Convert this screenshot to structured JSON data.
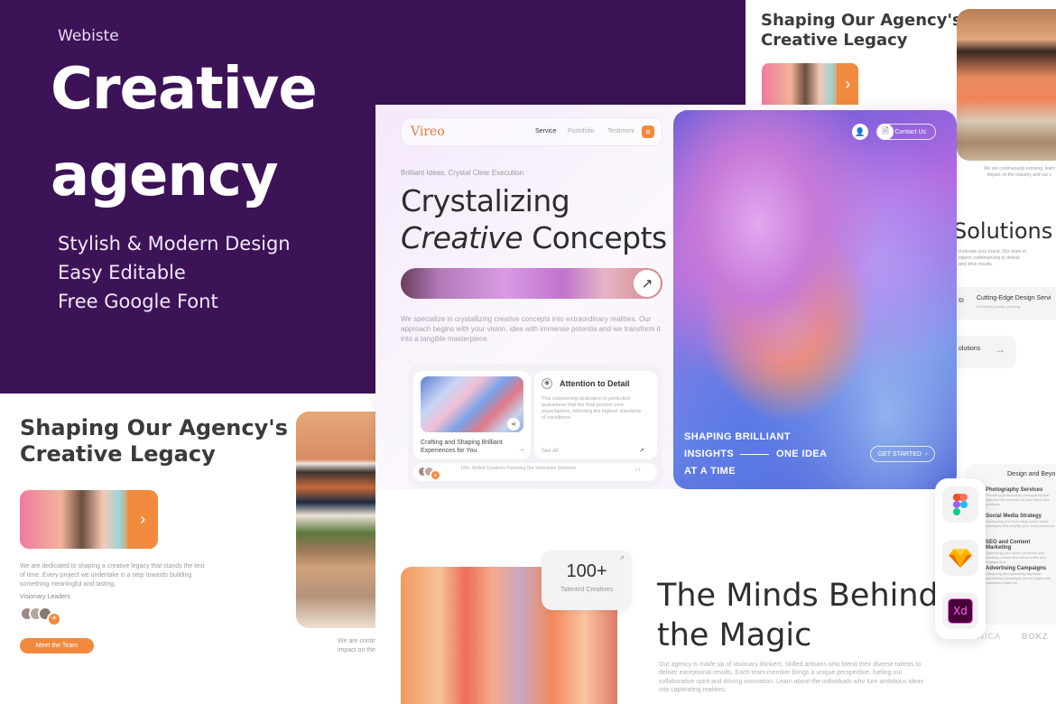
{
  "hero": {
    "tag": "Webiste",
    "title_line1": "Creative",
    "title_line2": "agency",
    "features": [
      "Stylish & Modern Design",
      "Easy Editable",
      "Free Google Font"
    ]
  },
  "legacy_section": {
    "title_line1": "Shaping Our Agency's",
    "title_line2": "Creative Legacy",
    "description": "We are dedicated to shaping a creative legacy that stands the test of time. Every project we undertake is a step towards building something meaningful and lasting.",
    "leaders_label": "Visionary Leaders",
    "cta": "Meet the Team",
    "continuing_text": "We are continuously evolving, learn",
    "continuing_text2": "impact on the industry and our c"
  },
  "top_right": {
    "title_line1": "Shaping Our Agency's",
    "title_line2": "Creative Legacy",
    "caption1": "We are continuously evolving, learn",
    "caption2": "impact on the industry and our c"
  },
  "solutions_strip": {
    "heading": "Solutions",
    "desc": [
      "d elevate your brand. Our team of",
      "expert craftsmanship to deliver",
      "and drive results."
    ],
    "service_title": "Cutting-Edge Design Servi",
    "service_desc": "Delivering visually stunning",
    "button": "olutions"
  },
  "main": {
    "logo": "Vireo",
    "nav": [
      "Service",
      "Portofolio",
      "Testimoni"
    ],
    "subtitle": "Brilliant Ideas, Crystal Clear Execution",
    "headline_line1": "Crystalizing",
    "headline_italic": "Creative",
    "headline_rest": " Concepts",
    "body": "We specialize in crystallizing creative concepts into extraordinary realities. Our approach begins with your vision, idea with immense potentia and we transform it into a tangible masterpiece.",
    "contact_label": "Contact Us",
    "slogan_line1": "SHAPING BRILLIANT",
    "slogan_line2a": "INSIGHTS",
    "slogan_line2b": "ONE IDEA",
    "slogan_line3": "AT A TIME",
    "get_started": "GET STARTED",
    "card1_title": "Crafting and Shaping Brilliant Experiences for You",
    "card2_title": "Attention to Detail",
    "card2_body": "This unwavering dedication to perfection guarantees that the final product your expectations, reflecting the highest standards of excellence.",
    "card2_link": "See All",
    "footer_text": "100+ Skilled Creatives Powering Our Innovative Solutions"
  },
  "team": {
    "stat_value": "100+",
    "stat_label": "Talented Creatives",
    "title_line1": "The Minds Behind",
    "title_line2": "the Magic",
    "body": "Our agency is made up of visionary thinkers, skilled artisans who blend their diverse talents to deliver exceptional results. Each team member brings a unique perspective, fueling our collaborative spirit and driving innovation. Learn about the individuals who turn ambitious ideas into captivating realities."
  },
  "tools": [
    "figma-icon",
    "sketch-icon",
    "adobe-xd-icon"
  ],
  "design_list": {
    "heading": "Design and Beyo",
    "items": [
      {
        "title": "Photography Services",
        "desc": "Providing professional photography that captures the essence of your brand and products."
      },
      {
        "title": "Social Media Strategy",
        "desc": "Developing and executing social media strategies that amplify your brand presence."
      },
      {
        "title": "SEO and Content Marketing",
        "desc": "Optimizing your online presence and creating content that drives traffic and engagement."
      },
      {
        "title": "Advertising Campaigns",
        "desc": "Designing and launching impactful advertising campaigns across digital and traditional platforms."
      }
    ],
    "logos": [
      "UNICA",
      "BOKZ"
    ]
  },
  "colors": {
    "purple": "#3d1358",
    "orange": "#f28a3e"
  }
}
